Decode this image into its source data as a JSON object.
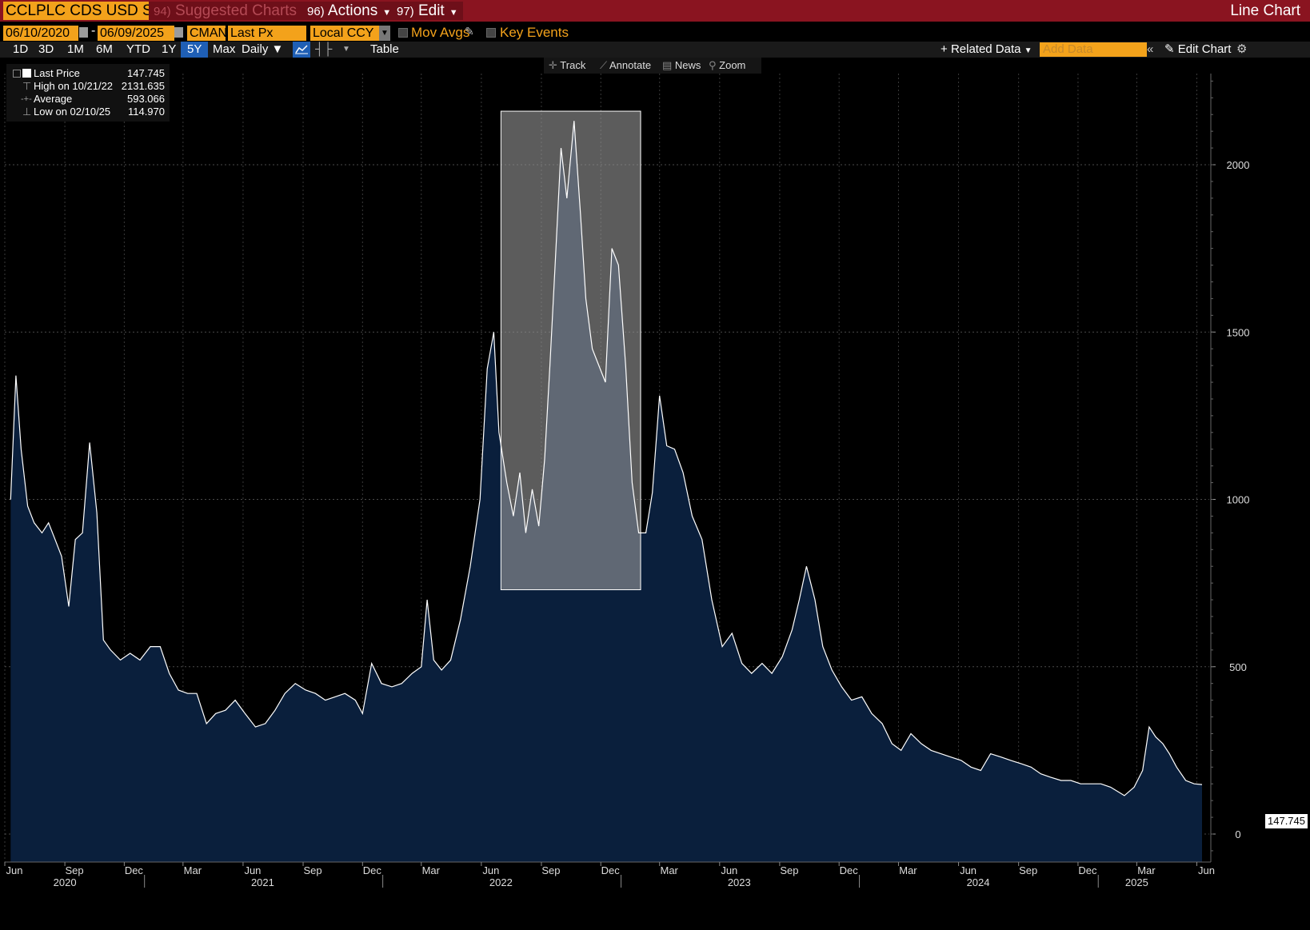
{
  "header": {
    "ticker": "CCLPLC CDS USD SR",
    "suggested": {
      "num": "94)",
      "label": "Suggested Charts"
    },
    "actions": {
      "num": "96)",
      "label": "Actions"
    },
    "edit": {
      "num": "97)",
      "label": "Edit"
    },
    "title": "Line Chart"
  },
  "controls": {
    "start_date": "06/10/2020",
    "end_date": "06/09/2025",
    "source": "CMAN",
    "field": "Last Px",
    "currency": "Local CCY",
    "mov_avgs": "Mov Avgs",
    "key_events": "Key Events"
  },
  "periods": [
    "1D",
    "3D",
    "1M",
    "6M",
    "YTD",
    "1Y",
    "5Y",
    "Max"
  ],
  "active_period": "5Y",
  "frequency": "Daily",
  "table_label": "Table",
  "related_data": "Related Data",
  "add_data_placeholder": "Add Data",
  "edit_chart": "Edit Chart",
  "tools": [
    "Track",
    "Annotate",
    "News",
    "Zoom"
  ],
  "legend": {
    "last": {
      "label": "Last Price",
      "value": "147.745"
    },
    "high": {
      "label": "High on 10/21/22",
      "value": "2131.635"
    },
    "avg": {
      "label": "Average",
      "value": "593.066"
    },
    "low": {
      "label": "Low on 02/10/25",
      "value": "114.970"
    }
  },
  "chart_data": {
    "type": "area",
    "title": "",
    "xlabel": "",
    "ylabel": "",
    "ylim": [
      -50,
      2250
    ],
    "yticks": [
      0,
      500,
      1000,
      1500,
      2000
    ],
    "last_value": "147.745",
    "grid": true,
    "colors": {
      "fill": "#0a1f3c",
      "line": "#ffffff",
      "highlight": "#8a8a8a"
    },
    "highlight_range": {
      "start": "2022-07-01",
      "end": "2023-01-31",
      "y_min": 730,
      "y_max": 2160
    },
    "month_ticks": [
      {
        "label": "Jun",
        "date": "2020-06-01"
      },
      {
        "label": "Sep",
        "date": "2020-09-01"
      },
      {
        "label": "Dec",
        "date": "2020-12-01"
      },
      {
        "label": "Mar",
        "date": "2021-03-01"
      },
      {
        "label": "Jun",
        "date": "2021-06-01"
      },
      {
        "label": "Sep",
        "date": "2021-09-01"
      },
      {
        "label": "Dec",
        "date": "2021-12-01"
      },
      {
        "label": "Mar",
        "date": "2022-03-01"
      },
      {
        "label": "Jun",
        "date": "2022-06-01"
      },
      {
        "label": "Sep",
        "date": "2022-09-01"
      },
      {
        "label": "Dec",
        "date": "2022-12-01"
      },
      {
        "label": "Mar",
        "date": "2023-03-01"
      },
      {
        "label": "Jun",
        "date": "2023-06-01"
      },
      {
        "label": "Sep",
        "date": "2023-09-01"
      },
      {
        "label": "Dec",
        "date": "2023-12-01"
      },
      {
        "label": "Mar",
        "date": "2024-03-01"
      },
      {
        "label": "Jun",
        "date": "2024-06-01"
      },
      {
        "label": "Sep",
        "date": "2024-09-01"
      },
      {
        "label": "Dec",
        "date": "2024-12-01"
      },
      {
        "label": "Mar",
        "date": "2025-03-01"
      },
      {
        "label": "Jun",
        "date": "2025-06-01"
      }
    ],
    "year_labels": [
      {
        "label": "2020",
        "date": "2020-09-01"
      },
      {
        "label": "2021",
        "date": "2021-07-01"
      },
      {
        "label": "2022",
        "date": "2022-07-01"
      },
      {
        "label": "2023",
        "date": "2023-07-01"
      },
      {
        "label": "2024",
        "date": "2024-07-01"
      },
      {
        "label": "2025",
        "date": "2025-03-01"
      }
    ],
    "series": [
      {
        "points": [
          [
            "2020-06-10",
            1000
          ],
          [
            "2020-06-18",
            1370
          ],
          [
            "2020-06-26",
            1150
          ],
          [
            "2020-07-06",
            980
          ],
          [
            "2020-07-16",
            930
          ],
          [
            "2020-07-28",
            900
          ],
          [
            "2020-08-07",
            930
          ],
          [
            "2020-08-17",
            880
          ],
          [
            "2020-08-27",
            830
          ],
          [
            "2020-09-07",
            680
          ],
          [
            "2020-09-17",
            880
          ],
          [
            "2020-09-28",
            900
          ],
          [
            "2020-10-09",
            1170
          ],
          [
            "2020-10-20",
            960
          ],
          [
            "2020-10-30",
            580
          ],
          [
            "2020-11-10",
            550
          ],
          [
            "2020-11-25",
            520
          ],
          [
            "2020-12-10",
            540
          ],
          [
            "2020-12-25",
            520
          ],
          [
            "2021-01-10",
            560
          ],
          [
            "2021-01-25",
            560
          ],
          [
            "2021-02-08",
            480
          ],
          [
            "2021-02-22",
            430
          ],
          [
            "2021-03-08",
            420
          ],
          [
            "2021-03-22",
            420
          ],
          [
            "2021-04-06",
            330
          ],
          [
            "2021-04-20",
            360
          ],
          [
            "2021-05-05",
            370
          ],
          [
            "2021-05-20",
            400
          ],
          [
            "2021-06-04",
            360
          ],
          [
            "2021-06-20",
            320
          ],
          [
            "2021-07-05",
            330
          ],
          [
            "2021-07-20",
            370
          ],
          [
            "2021-08-04",
            420
          ],
          [
            "2021-08-20",
            450
          ],
          [
            "2021-09-05",
            430
          ],
          [
            "2021-09-20",
            420
          ],
          [
            "2021-10-05",
            400
          ],
          [
            "2021-10-20",
            410
          ],
          [
            "2021-11-04",
            420
          ],
          [
            "2021-11-20",
            400
          ],
          [
            "2021-12-01",
            360
          ],
          [
            "2021-12-15",
            510
          ],
          [
            "2021-12-30",
            450
          ],
          [
            "2022-01-15",
            440
          ],
          [
            "2022-01-30",
            450
          ],
          [
            "2022-02-15",
            480
          ],
          [
            "2022-03-01",
            500
          ],
          [
            "2022-03-10",
            700
          ],
          [
            "2022-03-20",
            520
          ],
          [
            "2022-04-01",
            490
          ],
          [
            "2022-04-15",
            520
          ],
          [
            "2022-04-30",
            640
          ],
          [
            "2022-05-15",
            800
          ],
          [
            "2022-05-30",
            1000
          ],
          [
            "2022-06-10",
            1390
          ],
          [
            "2022-06-20",
            1500
          ],
          [
            "2022-06-28",
            1200
          ],
          [
            "2022-07-10",
            1050
          ],
          [
            "2022-07-20",
            950
          ],
          [
            "2022-07-30",
            1080
          ],
          [
            "2022-08-08",
            900
          ],
          [
            "2022-08-18",
            1030
          ],
          [
            "2022-08-28",
            920
          ],
          [
            "2022-09-06",
            1120
          ],
          [
            "2022-09-14",
            1400
          ],
          [
            "2022-09-22",
            1700
          ],
          [
            "2022-10-01",
            2050
          ],
          [
            "2022-10-10",
            1900
          ],
          [
            "2022-10-21",
            2131
          ],
          [
            "2022-10-31",
            1850
          ],
          [
            "2022-11-08",
            1600
          ],
          [
            "2022-11-18",
            1450
          ],
          [
            "2022-11-28",
            1400
          ],
          [
            "2022-12-08",
            1350
          ],
          [
            "2022-12-18",
            1750
          ],
          [
            "2022-12-28",
            1700
          ],
          [
            "2023-01-08",
            1400
          ],
          [
            "2023-01-18",
            1050
          ],
          [
            "2023-01-28",
            900
          ],
          [
            "2023-02-08",
            900
          ],
          [
            "2023-02-18",
            1020
          ],
          [
            "2023-03-01",
            1310
          ],
          [
            "2023-03-12",
            1160
          ],
          [
            "2023-03-24",
            1150
          ],
          [
            "2023-04-06",
            1080
          ],
          [
            "2023-04-20",
            950
          ],
          [
            "2023-05-05",
            880
          ],
          [
            "2023-05-20",
            700
          ],
          [
            "2023-06-05",
            560
          ],
          [
            "2023-06-20",
            600
          ],
          [
            "2023-07-05",
            510
          ],
          [
            "2023-07-20",
            480
          ],
          [
            "2023-08-05",
            510
          ],
          [
            "2023-08-20",
            480
          ],
          [
            "2023-09-05",
            530
          ],
          [
            "2023-09-20",
            610
          ],
          [
            "2023-10-01",
            700
          ],
          [
            "2023-10-12",
            800
          ],
          [
            "2023-10-25",
            700
          ],
          [
            "2023-11-06",
            560
          ],
          [
            "2023-11-20",
            490
          ],
          [
            "2023-12-05",
            440
          ],
          [
            "2023-12-20",
            400
          ],
          [
            "2024-01-05",
            410
          ],
          [
            "2024-01-20",
            360
          ],
          [
            "2024-02-05",
            330
          ],
          [
            "2024-02-20",
            270
          ],
          [
            "2024-03-05",
            250
          ],
          [
            "2024-03-20",
            300
          ],
          [
            "2024-04-05",
            270
          ],
          [
            "2024-04-20",
            250
          ],
          [
            "2024-05-05",
            240
          ],
          [
            "2024-05-20",
            230
          ],
          [
            "2024-06-05",
            220
          ],
          [
            "2024-06-20",
            200
          ],
          [
            "2024-07-05",
            190
          ],
          [
            "2024-07-20",
            240
          ],
          [
            "2024-08-05",
            230
          ],
          [
            "2024-08-20",
            220
          ],
          [
            "2024-09-05",
            210
          ],
          [
            "2024-09-20",
            200
          ],
          [
            "2024-10-05",
            180
          ],
          [
            "2024-10-20",
            170
          ],
          [
            "2024-11-05",
            160
          ],
          [
            "2024-11-20",
            160
          ],
          [
            "2024-12-05",
            150
          ],
          [
            "2024-12-20",
            150
          ],
          [
            "2025-01-05",
            150
          ],
          [
            "2025-01-20",
            140
          ],
          [
            "2025-02-10",
            115
          ],
          [
            "2025-02-25",
            140
          ],
          [
            "2025-03-10",
            190
          ],
          [
            "2025-03-20",
            320
          ],
          [
            "2025-03-30",
            290
          ],
          [
            "2025-04-10",
            270
          ],
          [
            "2025-04-20",
            240
          ],
          [
            "2025-05-01",
            200
          ],
          [
            "2025-05-15",
            160
          ],
          [
            "2025-05-28",
            150
          ],
          [
            "2025-06-09",
            148
          ]
        ]
      }
    ]
  }
}
